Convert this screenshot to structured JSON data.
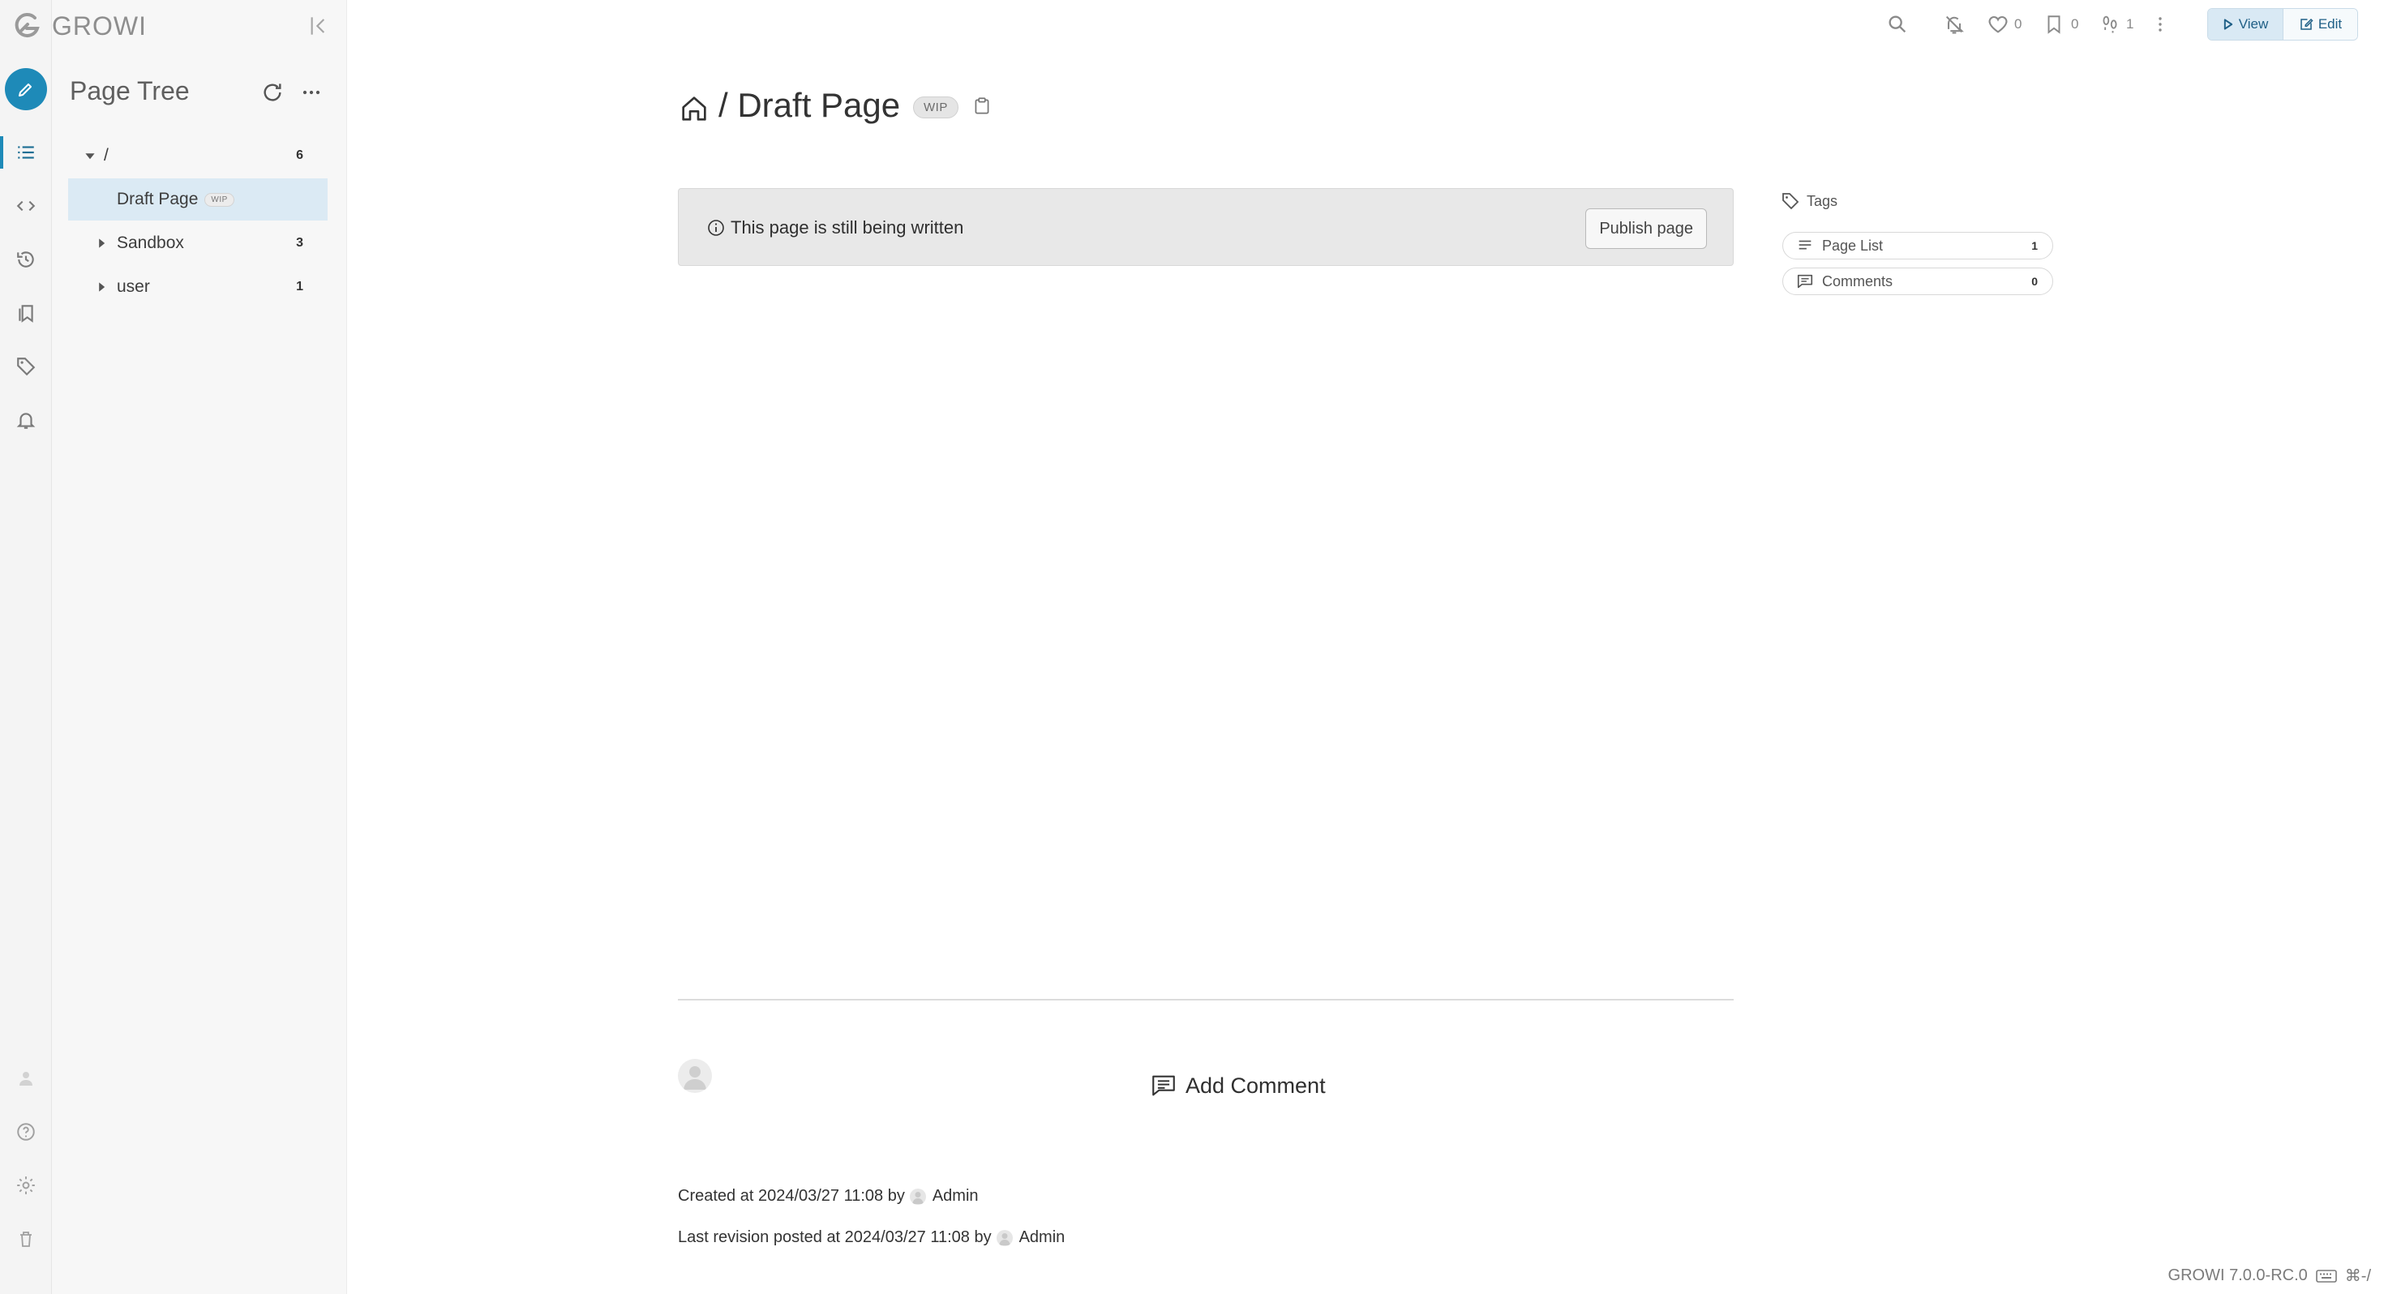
{
  "brand": {
    "name": "GROWI"
  },
  "sidebar": {
    "title": "Page Tree",
    "tree": [
      {
        "label": "/",
        "count": "6"
      },
      {
        "label": "Draft Page",
        "badge": "WIP"
      },
      {
        "label": "Sandbox",
        "count": "3"
      },
      {
        "label": "user",
        "count": "1"
      }
    ]
  },
  "toolbar": {
    "likes": "0",
    "bookmarks": "0",
    "seen": "1",
    "view_label": "View",
    "edit_label": "Edit"
  },
  "page": {
    "path_prefix": "/ ",
    "title": "Draft Page",
    "wip_badge": "WIP",
    "notice": "This page is still being written",
    "publish_label": "Publish page"
  },
  "side_panel": {
    "tags_label": "Tags",
    "page_list_label": "Page List",
    "page_list_count": "1",
    "comments_label": "Comments",
    "comments_count": "0"
  },
  "comments": {
    "add_label": "Add Comment"
  },
  "meta": {
    "created_prefix": "Created at 2024/03/27 11:08 by",
    "created_user": "Admin",
    "revision_prefix": "Last revision posted at 2024/03/27 11:08 by",
    "revision_user": "Admin"
  },
  "footer": {
    "version": "GROWI 7.0.0-RC.0",
    "shortcut": "⌘-/"
  },
  "colors": {
    "accent": "#1e8ab8",
    "selected_row": "#dbeaf4",
    "alert_bg": "#e8e8e8"
  }
}
